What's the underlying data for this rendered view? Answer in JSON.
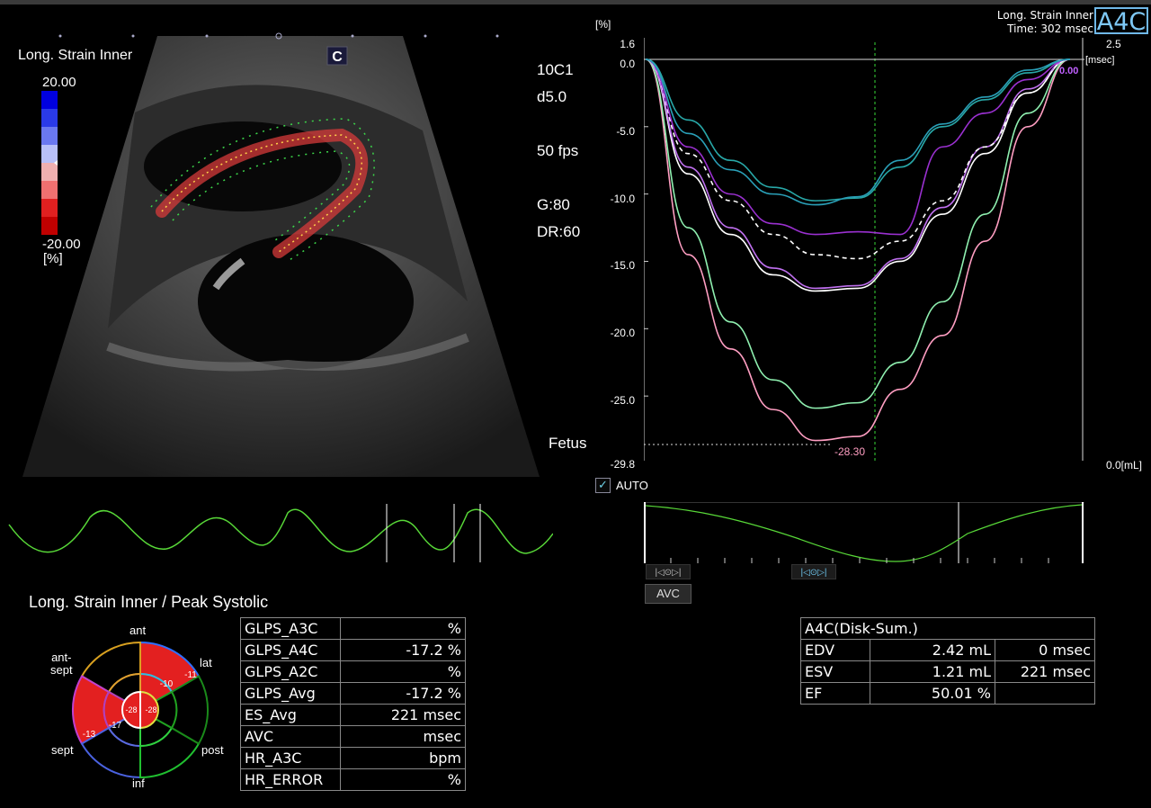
{
  "header": {
    "mode": "Long. Strain Inner",
    "time": "Time: 302 msec",
    "view": "A4C"
  },
  "image_legend": {
    "title": "Long. Strain Inner",
    "scale_max": "20.00",
    "scale_min": "-20.00",
    "unit": "[%]"
  },
  "params": {
    "probe": "10C1",
    "depth": "d5.0",
    "fps": "50 fps",
    "gain": "G:80",
    "dr": "DR:60",
    "preset": "Fetus"
  },
  "graph": {
    "y_unit": "[%]",
    "time_max": "2.5",
    "time_unit": "[msec]",
    "y_ticks": [
      "1.6",
      "0.0",
      "-5.0",
      "-10.0",
      "-15.0",
      "-20.0",
      "-25.0",
      "-29.8"
    ],
    "peak_label": "-28.30",
    "end_label": "0.00",
    "vol_label": "0.0[mL]",
    "auto_label": "AUTO",
    "auto_checked": true,
    "avc_label": "AVC"
  },
  "bottom": {
    "title": "Long. Strain Inner / Peak Systolic",
    "segments": {
      "ant": "ant",
      "ant_sept": "ant-\nsept",
      "lat": "lat",
      "sept": "sept",
      "post": "post",
      "inf": "inf"
    },
    "segment_values": {
      "lat_outer": "-11",
      "lat_mid": "-10",
      "sept_outer": "-13",
      "sept_mid": "-17",
      "apex_left": "-28",
      "apex_right": "-28"
    },
    "glps_rows": [
      {
        "key": "GLPS_A3C",
        "value": "%"
      },
      {
        "key": "GLPS_A4C",
        "value": "-17.2 %"
      },
      {
        "key": "GLPS_A2C",
        "value": "%"
      },
      {
        "key": "GLPS_Avg",
        "value": "-17.2 %"
      },
      {
        "key": "ES_Avg",
        "value": "221 msec"
      },
      {
        "key": "AVC",
        "value": "msec"
      },
      {
        "key": "HR_A3C",
        "value": "bpm"
      },
      {
        "key": "HR_ERROR",
        "value": "%"
      }
    ],
    "disk": {
      "title": "A4C(Disk-Sum.)",
      "rows": [
        {
          "key": "EDV",
          "value": "2.42 mL",
          "time": "0 msec"
        },
        {
          "key": "ESV",
          "value": "1.21 mL",
          "time": "221 msec"
        },
        {
          "key": "EF",
          "value": "50.01 %",
          "time": ""
        }
      ]
    }
  },
  "chart_data": {
    "type": "line",
    "title": "",
    "xlabel": "[msec]",
    "ylabel": "[%]",
    "ylim": [
      -29.8,
      1.6
    ],
    "x": [
      0,
      0.1,
      0.2,
      0.3,
      0.4,
      0.5,
      0.6,
      0.7,
      0.8,
      0.9,
      1.0
    ],
    "series": [
      {
        "values": [
          0,
          -14.5,
          -21.5,
          -26.0,
          -28.3,
          -28.0,
          -24.5,
          -20.5,
          -13.5,
          -5.0,
          0
        ],
        "color": "#ff9ec2"
      },
      {
        "values": [
          0,
          -12.5,
          -19.5,
          -23.8,
          -25.9,
          -25.5,
          -22.5,
          -18.0,
          -11.5,
          -4.0,
          0
        ],
        "color": "#8ff0b0"
      },
      {
        "values": [
          0,
          -8.5,
          -13.0,
          -16.0,
          -17.2,
          -17.0,
          -15.0,
          -11.5,
          -7.0,
          -2.5,
          0
        ],
        "color": "#ffffff"
      },
      {
        "values": [
          0,
          -8.0,
          -12.5,
          -15.5,
          -17.0,
          -16.8,
          -14.8,
          -11.0,
          -6.5,
          -2.2,
          0
        ],
        "color": "#c070f0"
      },
      {
        "values": [
          0,
          -7.0,
          -10.5,
          -13.0,
          -14.5,
          -14.8,
          -13.5,
          -10.5,
          -6.5,
          -2.5,
          0
        ],
        "color": "#ffffff"
      },
      {
        "values": [
          0,
          -6.5,
          -10.0,
          -12.2,
          -13.0,
          -12.8,
          -13.0,
          -6.5,
          -4.0,
          -1.5,
          0
        ],
        "color": "#9a30d0"
      },
      {
        "values": [
          0,
          -4.5,
          -7.5,
          -9.5,
          -10.5,
          -10.3,
          -8.0,
          -5.0,
          -3.0,
          -1.0,
          0
        ],
        "color": "#28a8a8"
      },
      {
        "values": [
          0,
          -5.5,
          -8.2,
          -10.0,
          -10.8,
          -10.2,
          -7.5,
          -4.8,
          -2.8,
          -0.8,
          0
        ],
        "color": "#2aa0b8"
      }
    ]
  }
}
